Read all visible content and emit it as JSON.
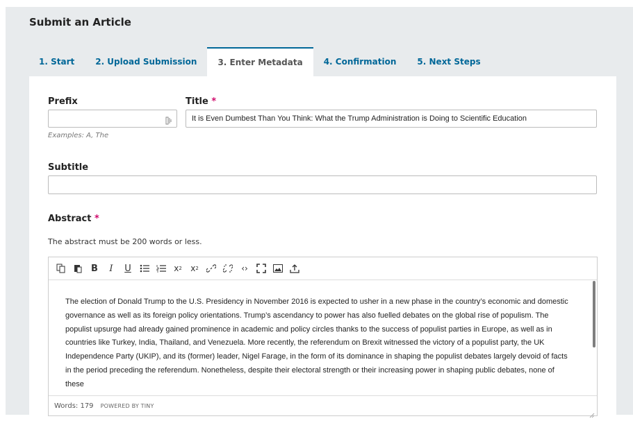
{
  "page": {
    "title": "Submit an Article"
  },
  "tabs": [
    {
      "label": "1. Start"
    },
    {
      "label": "2. Upload Submission"
    },
    {
      "label": "3. Enter Metadata"
    },
    {
      "label": "4. Confirmation"
    },
    {
      "label": "5. Next Steps"
    }
  ],
  "form": {
    "prefix": {
      "label": "Prefix",
      "value": "",
      "hint": "Examples: A, The"
    },
    "title": {
      "label": "Title",
      "required_mark": "*",
      "value": "It is Even Dumbest Than You Think: What the Trump Administration is Doing to Scientific Education"
    },
    "subtitle": {
      "label": "Subtitle",
      "value": ""
    },
    "abstract": {
      "label": "Abstract",
      "required_mark": "*",
      "description": "The abstract must be 200 words or less.",
      "text": "The election of Donald Trump to the U.S. Presidency in November 2016 is expected to usher in a new phase in the country’s economic and domestic governance as well as its foreign policy orientations. Trump’s ascendancy to power has also fuelled debates on the global rise of populism. The populist upsurge had already gained prominence in academic and policy circles thanks to the success of populist parties in Europe, as well as in countries like Turkey, India, Thailand, and Venezuela. More recently, the referendum on Brexit witnessed the victory of a populist party, the UK Independence Party (UKIP), and its (former) leader, Nigel Farage, in the form of its dominance in shaping the populist debates largely devoid of facts in the period preceding the referendum. Nonetheless, despite their electoral strength or their increasing power in shaping public debates, none of these",
      "word_count": "Words: 179",
      "powered_by": "POWERED BY TINY"
    }
  },
  "toolbar_icons": [
    "copy-icon",
    "paste-icon",
    "bold-icon",
    "italic-icon",
    "underline-icon",
    "bullet-list-icon",
    "numbered-list-icon",
    "superscript-icon",
    "subscript-icon",
    "link-icon",
    "unlink-icon",
    "code-icon",
    "fullscreen-icon",
    "image-icon",
    "upload-icon"
  ],
  "colors": {
    "accent": "#006798",
    "required": "#d00a6c",
    "background": "#e8ebed"
  }
}
